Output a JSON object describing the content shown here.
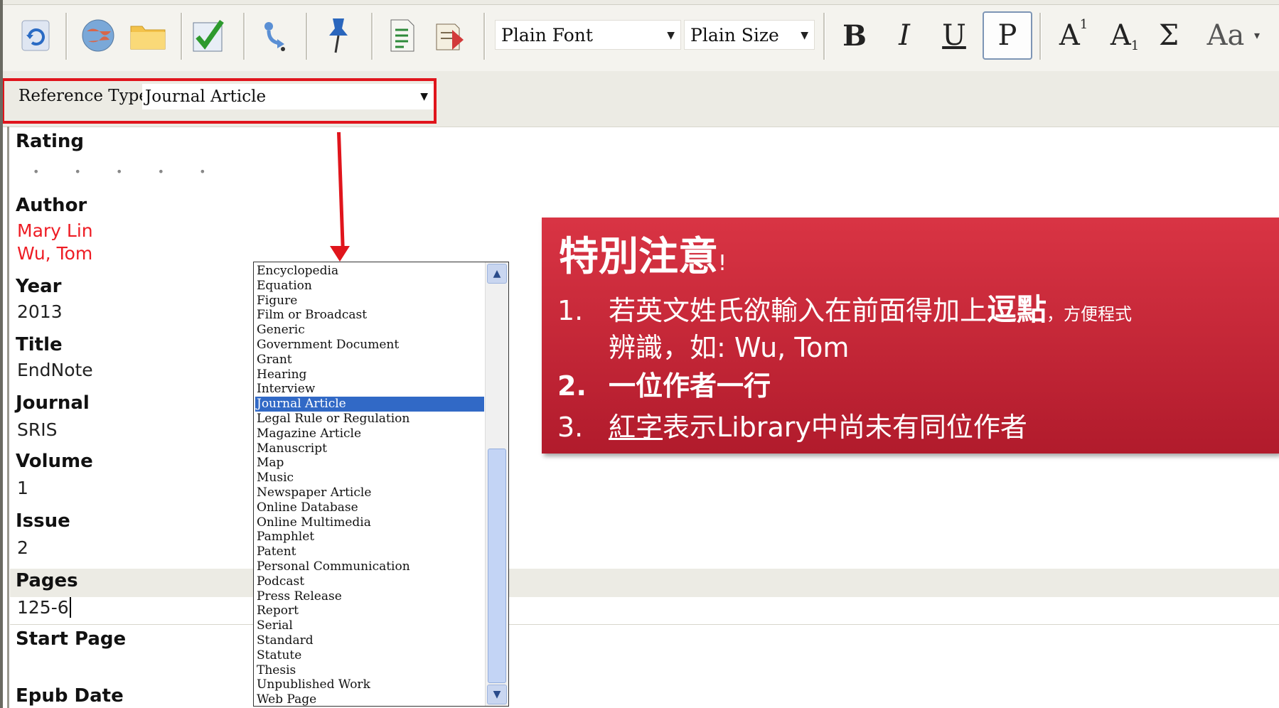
{
  "toolbar": {
    "icons": [
      "sync-icon",
      "globe-icon",
      "folder-icon",
      "checklist-icon",
      "insert-citation-icon",
      "pin-icon",
      "document-icon",
      "export-icon"
    ],
    "font_value": "Plain Font",
    "size_value": "Plain Size",
    "format_buttons": {
      "bold": "B",
      "italic": "I",
      "underline": "U",
      "plain": "P",
      "superscript_base": "A",
      "superscript_mark": "1",
      "subscript_base": "A",
      "subscript_mark": "1",
      "symbol": "Σ",
      "case": "Aa"
    }
  },
  "reference_type": {
    "label": "Reference Type:",
    "value": "Journal Article"
  },
  "fields": {
    "rating_label": "Rating",
    "rating_dots": "• • • • •",
    "author_label": "Author",
    "authors": [
      "Mary Lin",
      "Wu, Tom"
    ],
    "year_label": "Year",
    "year_value": "2013",
    "title_label": "Title",
    "title_value": "EndNote",
    "journal_label": "Journal",
    "journal_value": "SRIS",
    "volume_label": "Volume",
    "volume_value": "1",
    "issue_label": "Issue",
    "issue_value": "2",
    "pages_label": "Pages",
    "pages_value": "125-6",
    "start_page_label": "Start Page",
    "epub_date_label": "Epub Date"
  },
  "dropdown": {
    "items": [
      "Encyclopedia",
      "Equation",
      "Figure",
      "Film or Broadcast",
      "Generic",
      "Government Document",
      "Grant",
      "Hearing",
      "Interview",
      "Journal Article",
      "Legal Rule or Regulation",
      "Magazine Article",
      "Manuscript",
      "Map",
      "Music",
      "Newspaper Article",
      "Online Database",
      "Online Multimedia",
      "Pamphlet",
      "Patent",
      "Personal Communication",
      "Podcast",
      "Press Release",
      "Report",
      "Serial",
      "Standard",
      "Statute",
      "Thesis",
      "Unpublished Work",
      "Web Page"
    ],
    "selected_index": 9
  },
  "callout": {
    "title": "特別注意",
    "title_bang": "!",
    "item1_num": "1.",
    "item1_a": "若英文姓氏欲輸入在前面得加上",
    "item1_emph": "逗點",
    "item1_b": "，方便程式",
    "item1_line2": "辨識，如: Wu, Tom",
    "item2_num": "2.",
    "item2_text": "一位作者一行",
    "item3_num": "3.",
    "item3_ul": "紅字",
    "item3_text": "表示Library中尚未有同位作者"
  },
  "colors": {
    "highlight_red": "#e0151c",
    "author_red": "#ee1c24",
    "selection_blue": "#3169c6",
    "callout_red": "#c8263a"
  }
}
